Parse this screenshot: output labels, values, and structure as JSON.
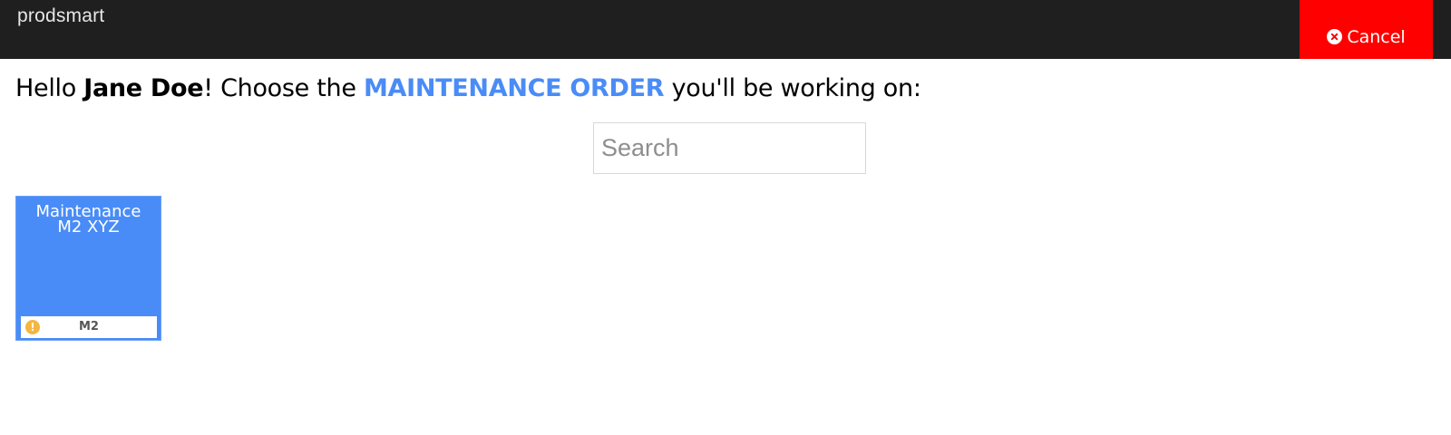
{
  "header": {
    "logo": "prodsmart",
    "cancel_label": "Cancel",
    "cancel_icon": "times-circle-icon",
    "bg_color": "#1f1f1f",
    "cancel_color": "#ff0000"
  },
  "greeting": {
    "prefix": "Hello ",
    "user_name": "Jane Doe",
    "middle": "! Choose the ",
    "entity": "MAINTENANCE ORDER",
    "suffix": " you'll be working on:",
    "entity_color": "#4a8cf7"
  },
  "search": {
    "placeholder": "Search",
    "value": ""
  },
  "orders": [
    {
      "title_line1": "Maintenance",
      "title_line2": "M2 XYZ",
      "code": "M2",
      "status_icon": "exclamation-circle-icon",
      "card_color": "#4a8cf7",
      "status_color": "#f4b63f"
    }
  ]
}
